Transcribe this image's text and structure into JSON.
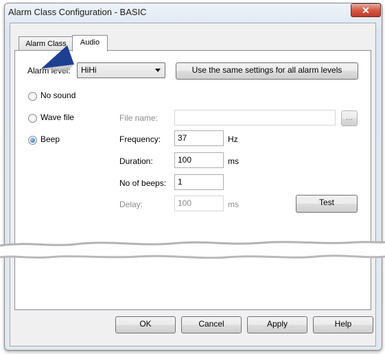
{
  "window": {
    "title": "Alarm Class Configuration - BASIC",
    "close_glyph": "✕"
  },
  "tabs": [
    {
      "label": "Alarm Class"
    },
    {
      "label": "Audio"
    }
  ],
  "audio": {
    "alarm_level_label": "Alarm level:",
    "alarm_level_value": "HiHi",
    "same_settings_button": "Use the same settings for all alarm levels",
    "radio_options": [
      {
        "label": "No sound",
        "selected": false
      },
      {
        "label": "Wave file",
        "selected": false
      },
      {
        "label": "Beep",
        "selected": true
      }
    ],
    "file_name_label": "File name:",
    "file_name_value": "",
    "browse_label": "...",
    "frequency_label": "Frequency:",
    "frequency_value": "37",
    "frequency_unit": "Hz",
    "duration_label": "Duration:",
    "duration_value": "100",
    "duration_unit": "ms",
    "beeps_label": "No of beeps:",
    "beeps_value": "1",
    "delay_label": "Delay:",
    "delay_value": "100",
    "delay_unit": "ms",
    "test_button": "Test"
  },
  "footer": {
    "ok": "OK",
    "cancel": "Cancel",
    "apply": "Apply",
    "help": "Help"
  },
  "colors": {
    "accent_pointer": "#1f3f93",
    "close_button": "#c8432e"
  }
}
